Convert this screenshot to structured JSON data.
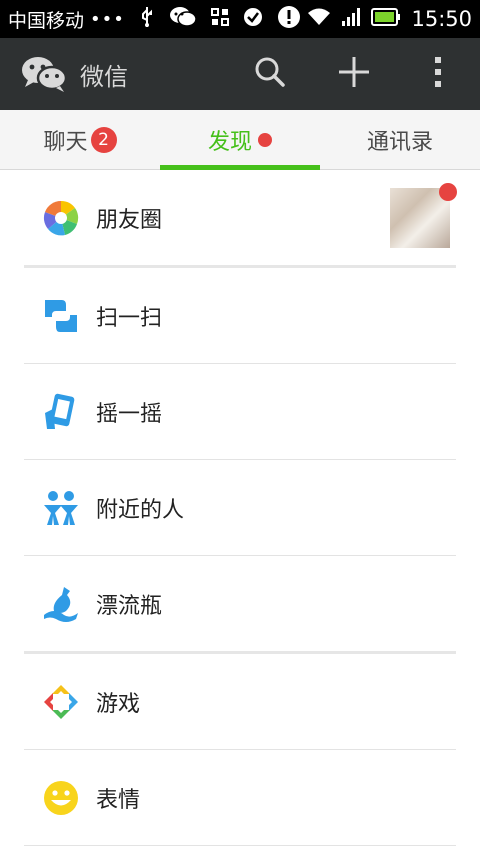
{
  "status_bar": {
    "carrier": "中国移动",
    "dots": "•••",
    "time": "15:50",
    "icons": [
      "usb-icon",
      "wechat-notification-icon",
      "qr-icon",
      "check-circle-icon",
      "alert-icon",
      "wifi-icon",
      "signal-icon",
      "battery-icon"
    ]
  },
  "action_bar": {
    "title": "微信",
    "actions": [
      "search-icon",
      "plus-icon",
      "overflow-menu-icon"
    ]
  },
  "tabs": [
    {
      "label": "聊天",
      "badge": "2"
    },
    {
      "label": "发现",
      "active": true,
      "dot": true
    },
    {
      "label": "通讯录"
    }
  ],
  "discover": {
    "moments": {
      "label": "朋友圈"
    },
    "scan": {
      "label": "扫一扫"
    },
    "shake": {
      "label": "摇一摇"
    },
    "nearby": {
      "label": "附近的人"
    },
    "bottle": {
      "label": "漂流瓶"
    },
    "games": {
      "label": "游戏"
    },
    "stickers": {
      "label": "表情"
    }
  },
  "colors": {
    "accent": "#45c01a",
    "badge": "#e64340",
    "actionbar": "#2e3132"
  }
}
